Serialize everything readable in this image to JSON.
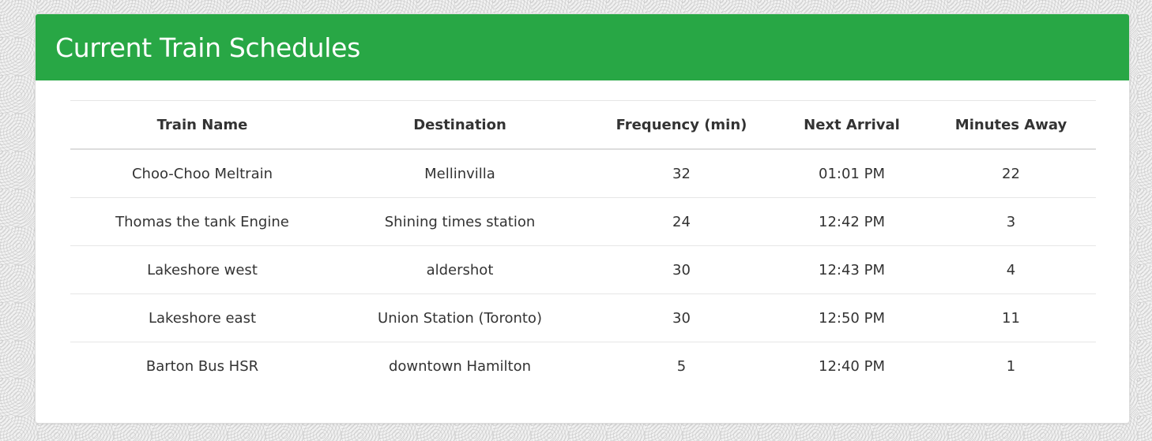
{
  "panel": {
    "title": "Current Train Schedules"
  },
  "table": {
    "headers": [
      "Train Name",
      "Destination",
      "Frequency (min)",
      "Next Arrival",
      "Minutes Away"
    ],
    "rows": [
      [
        "Choo-Choo Meltrain",
        "Mellinvilla",
        "32",
        "01:01 PM",
        "22"
      ],
      [
        "Thomas the tank Engine",
        "Shining times station",
        "24",
        "12:42 PM",
        "3"
      ],
      [
        "Lakeshore west",
        "aldershot",
        "30",
        "12:43 PM",
        "4"
      ],
      [
        "Lakeshore east",
        "Union Station (Toronto)",
        "30",
        "12:50 PM",
        "11"
      ],
      [
        "Barton Bus HSR",
        "downtown Hamilton",
        "5",
        "12:40 PM",
        "1"
      ]
    ]
  },
  "colors": {
    "header_green": "#28a745",
    "text": "#333333",
    "background": "#f1f1f1"
  }
}
